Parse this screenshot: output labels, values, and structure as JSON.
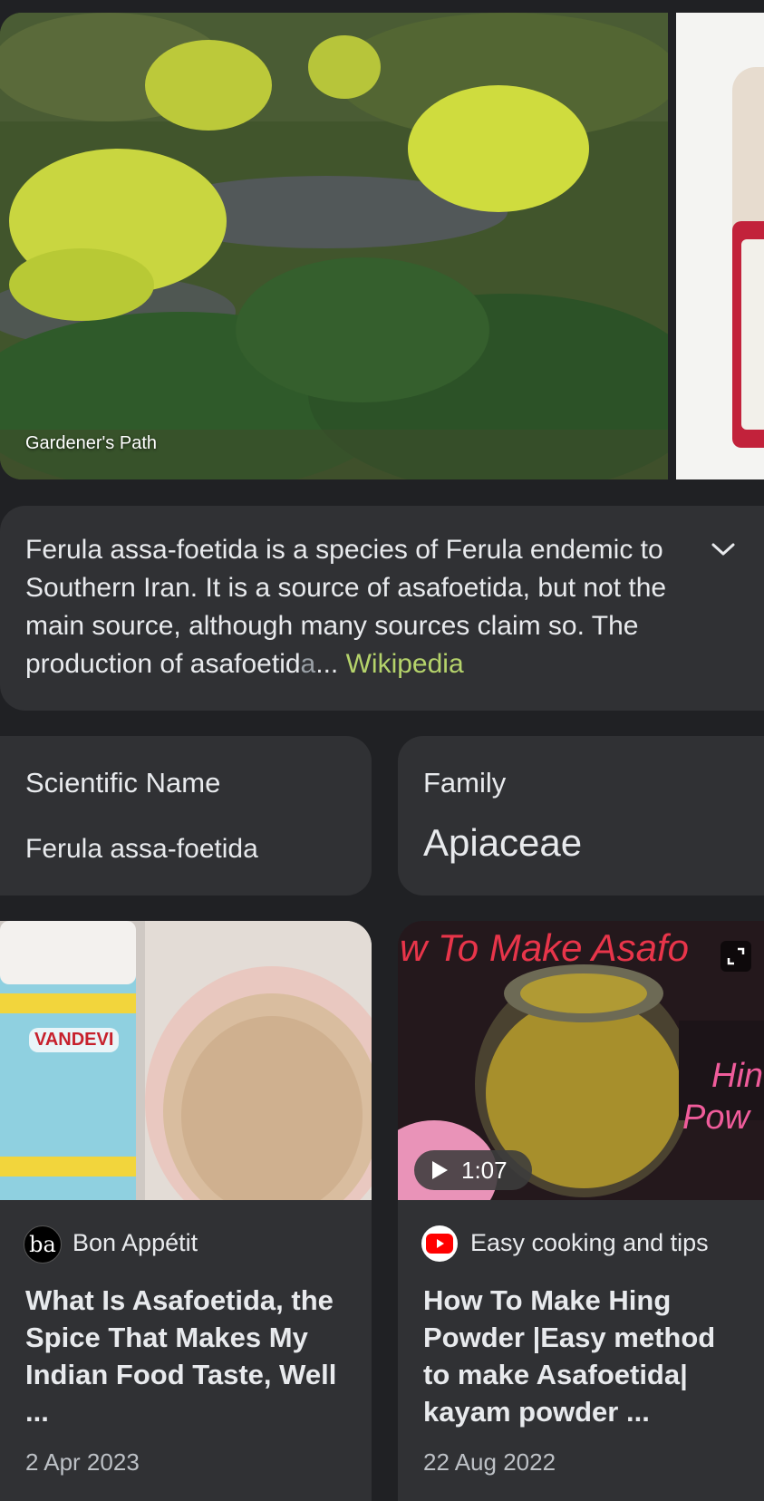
{
  "carousel": {
    "main_image_caption": "Gardener's Path",
    "main_image_icon": "ferula-plant-photo",
    "side_image_icon": "spice-jar-photo"
  },
  "description": {
    "text_main": "Ferula assa-foetida is a species of Ferula endemic to Southern Iran. It is a source of asafoetida, but not the main source, although many sources claim so. The production of asafoetid",
    "text_fade": "a",
    "ellipsis": "...",
    "source_label": "Wikipedia",
    "expand_icon": "chevron-down-icon"
  },
  "facts": [
    {
      "label": "Scientific Name",
      "value": "Ferula assa-foetida"
    },
    {
      "label": "Family",
      "value": "Apiaceae"
    }
  ],
  "articles": [
    {
      "source_logo_text": "ba",
      "source": "Bon Appétit",
      "title": "What Is Asafoetida, the Spice That Makes My Indian Food Taste, Well ...",
      "date": "2 Apr 2023",
      "thumb_label": "VANDEVI"
    },
    {
      "source": "Easy cooking and tips",
      "title": "How To Make Hing Powder |Easy method to make Asafoetida| kayam powder ...",
      "date": "22 Aug 2022",
      "video_duration": "1:07",
      "thumb_overlay_text": "w To Make Asafo",
      "thumb_side_text_1": "Hin",
      "thumb_side_text_2": "Pow"
    }
  ],
  "colors": {
    "background": "#202124",
    "card": "#303134",
    "source_link": "#b5d36b",
    "youtube_red": "#ff0000"
  }
}
